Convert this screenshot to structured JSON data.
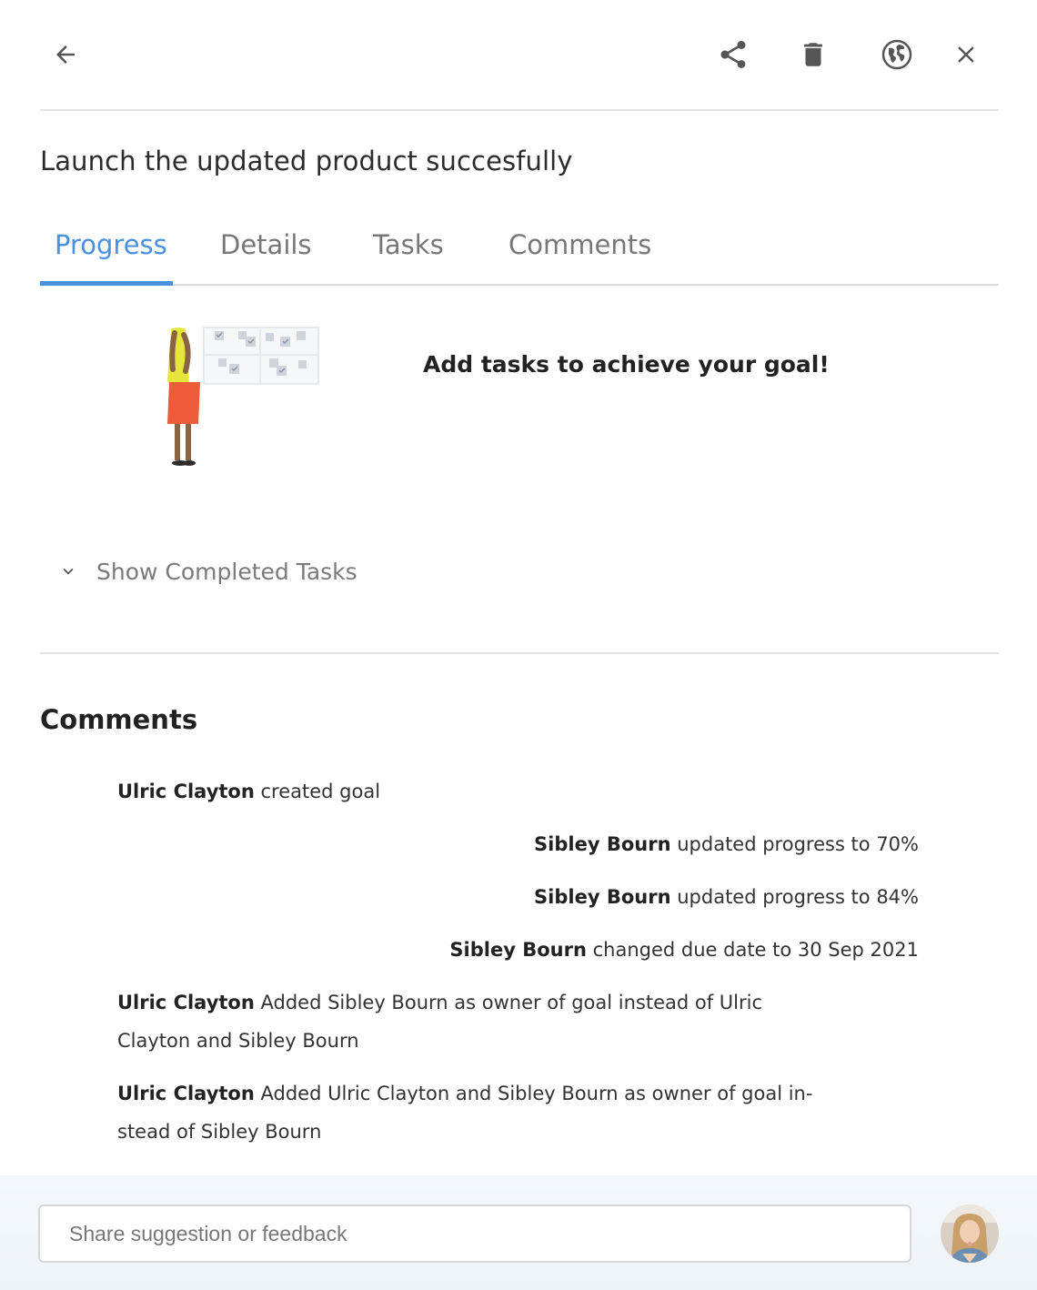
{
  "header": {
    "icons": [
      "arrow-left-icon",
      "share-icon",
      "trash-icon",
      "globe-icon",
      "close-icon"
    ]
  },
  "goal": {
    "title": "Launch the updated product succesfully"
  },
  "tabs": [
    {
      "label": "Progress",
      "active": true
    },
    {
      "label": "Details",
      "active": false
    },
    {
      "label": "Tasks",
      "active": false
    },
    {
      "label": "Comments",
      "active": false
    }
  ],
  "progress": {
    "empty_message": "Add tasks to achieve your goal!",
    "show_completed_label": "Show Completed Tasks"
  },
  "comments": {
    "heading": "Comments",
    "items": [
      {
        "author": "Ulric Clayton",
        "line1": "created goal",
        "line2": ""
      },
      {
        "author": "Sibley Bourn",
        "line1": "updated progress to 70%",
        "line2": ""
      },
      {
        "author": "Sibley Bourn",
        "line1": "updated progress to 84%",
        "line2": ""
      },
      {
        "author": "Sibley Bourn",
        "line1": "changed due date to 30 Sep 2021",
        "line2": ""
      },
      {
        "author": "Ulric Clayton",
        "line1": "Added Sibley Bourn as owner of goal instead of Ulric",
        "line2": "Clayton and Sibley Bourn"
      },
      {
        "author": "Ulric Clayton",
        "line1": "Added Ulric Clayton and Sibley Bourn as owner of goal in-",
        "line2": "stead of Sibley Bourn"
      }
    ]
  },
  "footer": {
    "feedback_placeholder": "Share suggestion or feedback"
  },
  "colors": {
    "accent": "#4a90e2",
    "icon": "#555555"
  }
}
